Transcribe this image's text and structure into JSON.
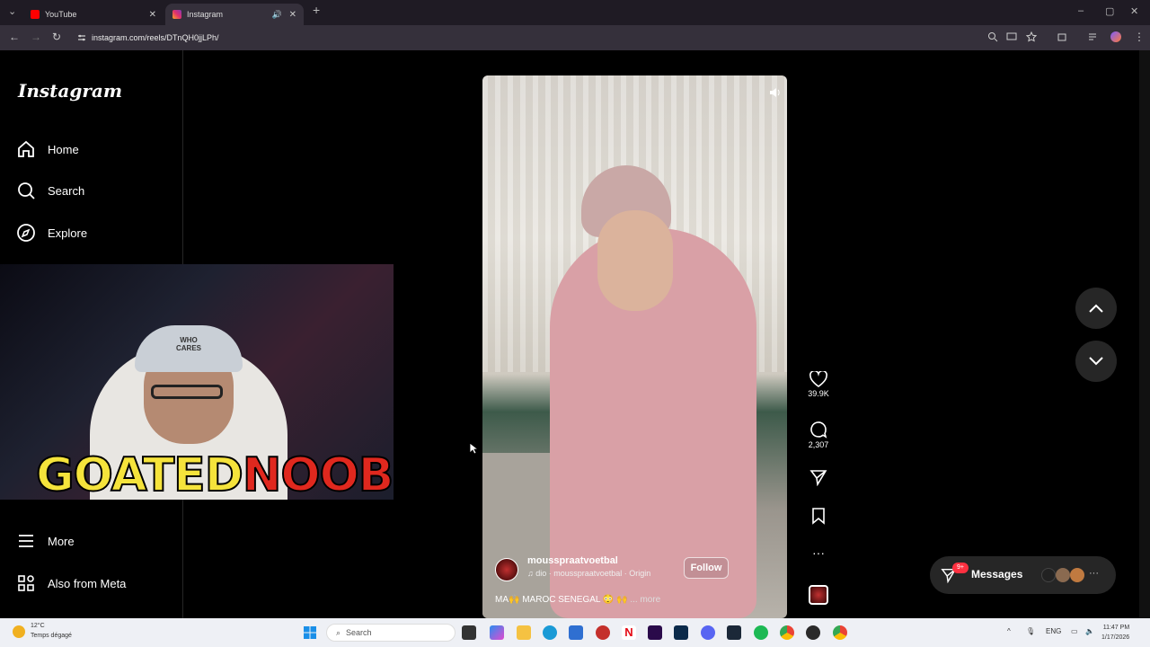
{
  "browser": {
    "tabs": [
      {
        "title": "YouTube",
        "color": "#ff0000"
      },
      {
        "title": "Instagram",
        "color": "#e1306c"
      }
    ],
    "url": "instagram.com/reels/DTnQH0jjLPh/"
  },
  "sidebar": {
    "logo": "Instagram",
    "items": [
      {
        "label": "Home",
        "icon": "home-icon"
      },
      {
        "label": "Search",
        "icon": "search-icon"
      },
      {
        "label": "Explore",
        "icon": "compass-icon"
      },
      {
        "label": "More",
        "icon": "menu-icon"
      },
      {
        "label": "Also from Meta",
        "icon": "meta-icon"
      }
    ]
  },
  "overlay": {
    "cap_text": "WHO CARES",
    "brand_part1": "GOATED",
    "brand_part2": "NOOBIE"
  },
  "reel": {
    "username": "mousspraatvoetbal",
    "audio": "♫ dio · mousspraatvoetbal · Origin",
    "follow_label": "Follow",
    "caption": "MA🙌 MAROC SENEGAL 😳 🙌",
    "caption_more": "... more",
    "likes": "39.9K",
    "comments": "2,307"
  },
  "messages": {
    "label": "Messages",
    "badge": "9+"
  },
  "taskbar": {
    "weather_temp": "12°C",
    "weather_desc": "Temps dégagé",
    "search_placeholder": "Search",
    "lang": "ENG",
    "time": "11:47 PM",
    "date": "1/17/2026"
  }
}
